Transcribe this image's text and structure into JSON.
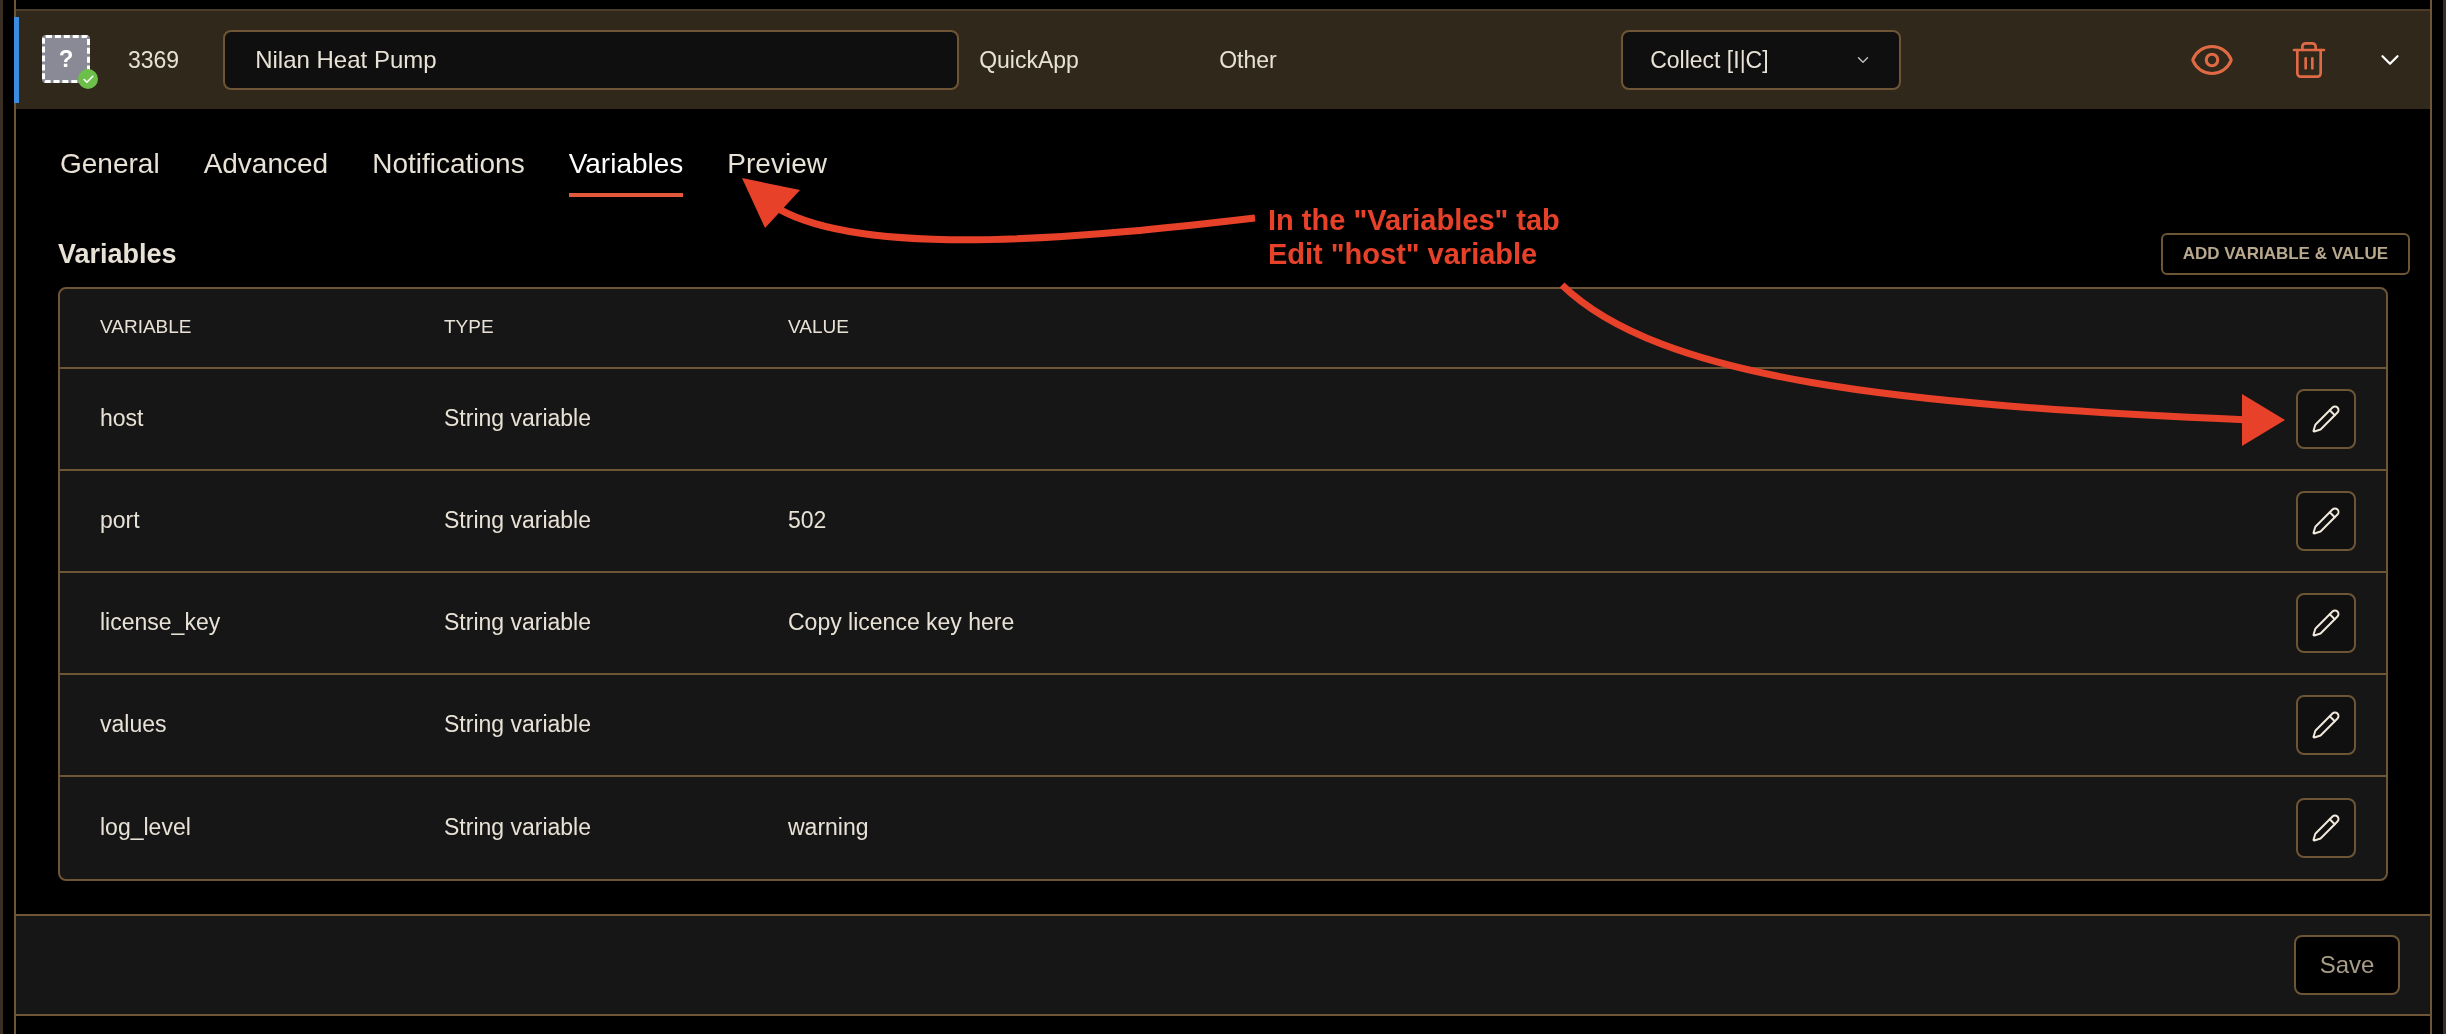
{
  "device": {
    "icon_glyph": "?",
    "verified": true,
    "id": "3369",
    "name": "Nilan Heat Pump",
    "type": "QuickApp",
    "category": "Other",
    "mode": "Collect [I|C]"
  },
  "tabs": [
    {
      "label": "General",
      "selected": false
    },
    {
      "label": "Advanced",
      "selected": false
    },
    {
      "label": "Notifications",
      "selected": false
    },
    {
      "label": "Variables",
      "selected": true
    },
    {
      "label": "Preview",
      "selected": false
    }
  ],
  "section_title": "Variables",
  "add_button": "ADD VARIABLE & VALUE",
  "table": {
    "columns": [
      "VARIABLE",
      "TYPE",
      "VALUE"
    ],
    "rows": [
      {
        "variable": "host",
        "type": "String variable",
        "value": ""
      },
      {
        "variable": "port",
        "type": "String variable",
        "value": "502"
      },
      {
        "variable": "license_key",
        "type": "String variable",
        "value": "Copy licence key here"
      },
      {
        "variable": "values",
        "type": "String variable",
        "value": ""
      },
      {
        "variable": "log_level",
        "type": "String variable",
        "value": "warning"
      }
    ]
  },
  "save_button": "Save",
  "annotation": {
    "text": "In the \"Variables\" tab\nEdit \"host\" variable"
  }
}
